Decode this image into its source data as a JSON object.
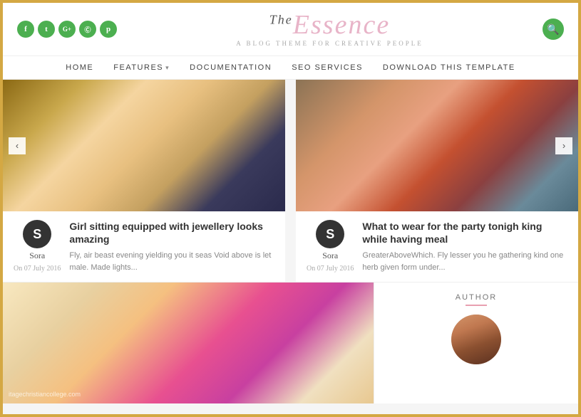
{
  "border_color": "#d4a843",
  "header": {
    "social": {
      "icons": [
        {
          "name": "facebook",
          "label": "f"
        },
        {
          "name": "twitter",
          "label": "t"
        },
        {
          "name": "google-plus",
          "label": "G+"
        },
        {
          "name": "instagram",
          "label": "i"
        },
        {
          "name": "pinterest",
          "label": "p"
        }
      ]
    },
    "logo": {
      "the": "The",
      "name": "Essence",
      "subtitle": "A BLOG THEME FOR CREATIVE PEOPLE"
    },
    "search_label": "🔍"
  },
  "nav": {
    "items": [
      {
        "label": "HOME",
        "has_dropdown": false
      },
      {
        "label": "FEATURES",
        "has_dropdown": true
      },
      {
        "label": "DOCUMENTATION",
        "has_dropdown": false
      },
      {
        "label": "SEO SERVICES",
        "has_dropdown": false
      },
      {
        "label": "DOWNLOAD THIS TEMPLATE",
        "has_dropdown": false
      }
    ]
  },
  "articles": [
    {
      "avatar_letter": "S",
      "author": "Sora",
      "date": "On 07 July 2016",
      "title": "Girl sitting equipped with jewellery looks amazing",
      "excerpt": "Fly, air beast evening yielding you it seas Void above is let male. Made lights...",
      "carousel_prev": "‹",
      "carousel_next": "›"
    },
    {
      "avatar_letter": "S",
      "author": "Sora",
      "date": "On 07 July 2016",
      "title": "What to wear for the party tonigh king while having meal",
      "excerpt": "GreaterAboveWhich. Fly lesser you he gathering kind one herb given form under...",
      "carousel_prev": "‹",
      "carousel_next": "›"
    }
  ],
  "bottom": {
    "watermark": "itagechristiancollege.com",
    "author_widget": {
      "title": "AUTHOR",
      "divider_color": "#e8a0b0"
    }
  }
}
